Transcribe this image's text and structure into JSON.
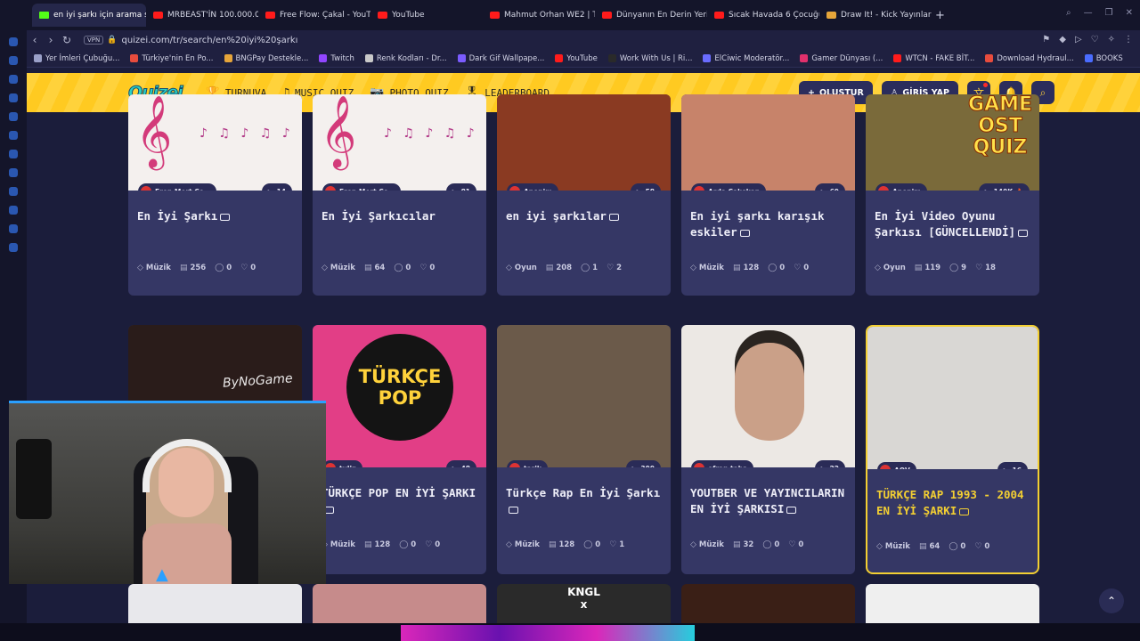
{
  "browser": {
    "tabs": [
      {
        "label": "en iyi şarkı için arama sor",
        "type": "active"
      },
      {
        "label": "MRBEAST'İN 100.000.000",
        "type": "yt"
      },
      {
        "label": "Free Flow: Çakal - YouTu",
        "type": "yt"
      },
      {
        "label": "YouTube",
        "type": "yt"
      },
      {
        "label": "Mahmut Orhan WE2 | To",
        "type": "yt"
      },
      {
        "label": "Dünyanın En Derin Yerin",
        "type": "yt"
      },
      {
        "label": "Sıcak Havada 6 Çocuğun",
        "type": "yt"
      },
      {
        "label": "Draw It! - Kick Yayınları İç",
        "type": "other"
      }
    ],
    "url": "quizei.com/tr/search/en%20iyi%20şarkı",
    "vpn_label": "VPN",
    "bookmarks": [
      "Yer İmleri Çubuğu...",
      "Türkiye'nin En Po...",
      "BNGPay Destekle...",
      "Twitch",
      "Renk Kodları - Dr...",
      "Dark Gif Wallpape...",
      "YouTube",
      "Work With Us | Ri...",
      "ElCiwic Moderatör...",
      "Gamer Dünyası (...",
      "WTCN - FAKE BİT...",
      "Download Hydraul...",
      "BOOKS"
    ]
  },
  "site": {
    "logo": "Quizei",
    "nav": [
      {
        "label": "TURNUVA",
        "icon": "trophy-icon",
        "glyph": "🏆"
      },
      {
        "label": "MUSIC QUIZ",
        "icon": "music-icon",
        "glyph": "♫"
      },
      {
        "label": "PHOTO QUIZ",
        "icon": "camera-icon",
        "glyph": "📷"
      },
      {
        "label": "LEADERBOARD",
        "icon": "medal-icon",
        "glyph": "🎖"
      }
    ],
    "create_label": "OLUŞTUR",
    "login_label": "GİRİŞ YAP"
  },
  "cards": [
    {
      "title": "En İyi Şarkı",
      "author": "Eren Mert Çe…",
      "plays": "14",
      "category": "Müzik",
      "questions": "256",
      "comments": "0",
      "likes": "0",
      "thumb": "#f4f0ee",
      "video": true
    },
    {
      "title": "En İyi Şarkıcılar",
      "author": "Eren Mert Çe…",
      "plays": "81",
      "category": "Müzik",
      "questions": "64",
      "comments": "0",
      "likes": "0",
      "thumb": "#f4f0ee",
      "video": false
    },
    {
      "title": "en iyi şarkılar",
      "author": "Anonim",
      "plays": "58",
      "category": "Oyun",
      "questions": "208",
      "comments": "1",
      "likes": "2",
      "thumb": "#8a3a22",
      "video": true
    },
    {
      "title": "En iyi şarkı karışık eskiler",
      "author": "Arda Çalışkan",
      "plays": "69",
      "category": "Müzik",
      "questions": "128",
      "comments": "0",
      "likes": "0",
      "thumb": "#c7836a",
      "video": true
    },
    {
      "title": "En İyi Video Oyunu Şarkısı [GÜNCELLENDİ]",
      "author": "Anonim",
      "plays": "140K 🔥",
      "category": "Oyun",
      "questions": "119",
      "comments": "9",
      "likes": "18",
      "thumb": "#7a6a3a",
      "video": true
    },
    {
      "title": "",
      "author": "",
      "plays": "",
      "category": "",
      "questions": "",
      "comments": "",
      "likes": "",
      "thumb": "#2a1c1a",
      "video": false
    },
    {
      "title": "TÜRKÇE POP EN İYİ ŞARKI",
      "author": "tulip",
      "plays": "48",
      "category": "Müzik",
      "questions": "128",
      "comments": "0",
      "likes": "0",
      "thumb": "#e23e86",
      "video": true
    },
    {
      "title": "Türkçe Rap En İyi Şarkı",
      "author": "tarik",
      "plays": "300",
      "category": "Müzik",
      "questions": "128",
      "comments": "0",
      "likes": "1",
      "thumb": "#6b5a4a",
      "video": true
    },
    {
      "title": "YOUTBER VE YAYINCILARIN EN İYİ ŞARKISI",
      "author": "efran taha",
      "plays": "22",
      "category": "Müzik",
      "questions": "32",
      "comments": "0",
      "likes": "0",
      "thumb": "#ece8e4",
      "video": true
    },
    {
      "title": "TÜRKÇE RAP 1993 - 2004 EN İYİ ŞARKI",
      "author": "AOV",
      "plays": "16",
      "category": "Müzik",
      "questions": "64",
      "comments": "0",
      "likes": "0",
      "thumb": "#d9d7d4",
      "video": true
    }
  ],
  "overlay": {
    "poster_text": [
      "TÜRKÇE",
      "POP"
    ],
    "game_poster_text": [
      "GAME",
      "OST",
      "QUIZ"
    ],
    "signature": "ByNoGame",
    "bottom_row_text": [
      "KNGL",
      "x"
    ]
  }
}
